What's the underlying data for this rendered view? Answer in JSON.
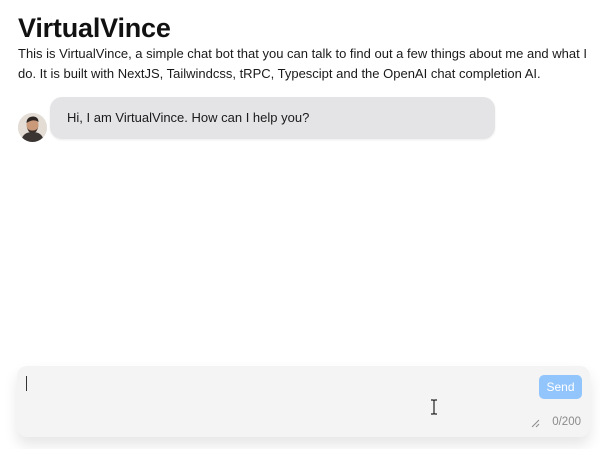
{
  "header": {
    "title": "VirtualVince",
    "intro": "This is VirtualVince, a simple chat bot that you can talk to find out a few things about me and what I do. It is built with NextJS, Tailwindcss, tRPC, Typescipt and the OpenAI chat completion AI."
  },
  "chat": {
    "messages": [
      {
        "sender": "bot",
        "text": "Hi, I am VirtualVince. How can I help you?"
      }
    ]
  },
  "composer": {
    "value": "",
    "send_label": "Send",
    "char_count": "0/200"
  },
  "colors": {
    "bubble_bg": "#e4e4e7",
    "send_button_bg": "#93c5fd",
    "composer_bg": "#f4f4f5"
  },
  "icons": {
    "avatar": "user-photo-avatar",
    "resize": "textarea-resize-icon",
    "mouse_cursor": "text-cursor-icon"
  }
}
